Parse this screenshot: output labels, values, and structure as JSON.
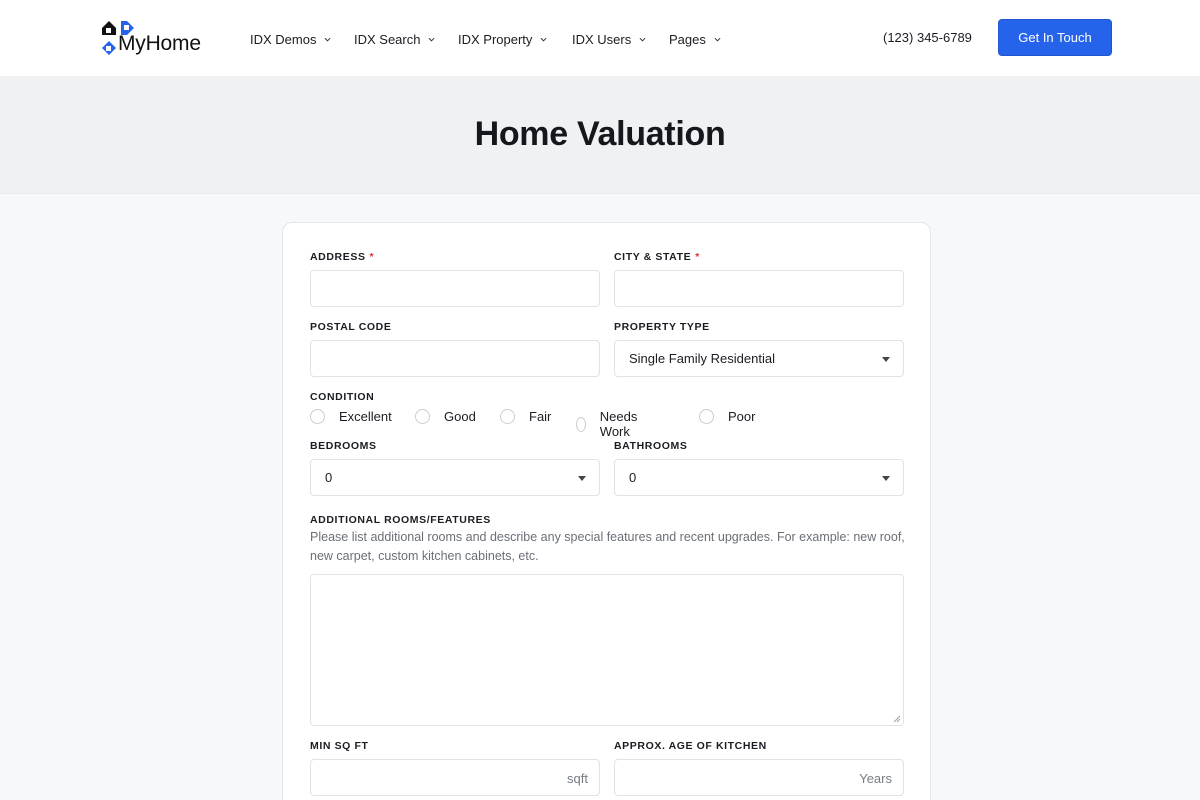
{
  "brand": {
    "name": "MyHome",
    "primary_color": "#2563eb"
  },
  "nav": {
    "items": [
      {
        "label": "IDX Demos"
      },
      {
        "label": "IDX Search"
      },
      {
        "label": "IDX Property"
      },
      {
        "label": "IDX Users"
      },
      {
        "label": "Pages"
      }
    ],
    "phone": "(123) 345-6789",
    "cta_label": "Get In Touch"
  },
  "page": {
    "title": "Home Valuation"
  },
  "form": {
    "address": {
      "label": "ADDRESS",
      "required_mark": "*",
      "value": ""
    },
    "city_state": {
      "label": "CITY & STATE",
      "required_mark": "*",
      "value": ""
    },
    "postal_code": {
      "label": "POSTAL CODE",
      "value": ""
    },
    "property_type": {
      "label": "PROPERTY TYPE",
      "selected": "Single Family Residential"
    },
    "condition": {
      "label": "CONDITION",
      "options": [
        "Excellent",
        "Good",
        "Fair",
        "Needs Work",
        "Poor"
      ],
      "selected": null
    },
    "bedrooms": {
      "label": "BEDROOMS",
      "selected": "0"
    },
    "bathrooms": {
      "label": "BATHROOMS",
      "selected": "0"
    },
    "additional": {
      "label": "ADDITIONAL ROOMS/FEATURES",
      "help": "Please list additional rooms and describe any special features and recent upgrades. For example: new roof, new carpet, custom kitchen cabinets, etc.",
      "value": ""
    },
    "min_sqft": {
      "label": "MIN SQ FT",
      "suffix": "sqft",
      "value": ""
    },
    "kitchen_age": {
      "label": "APPROX. AGE OF KITCHEN",
      "suffix": "Years",
      "value": ""
    }
  }
}
